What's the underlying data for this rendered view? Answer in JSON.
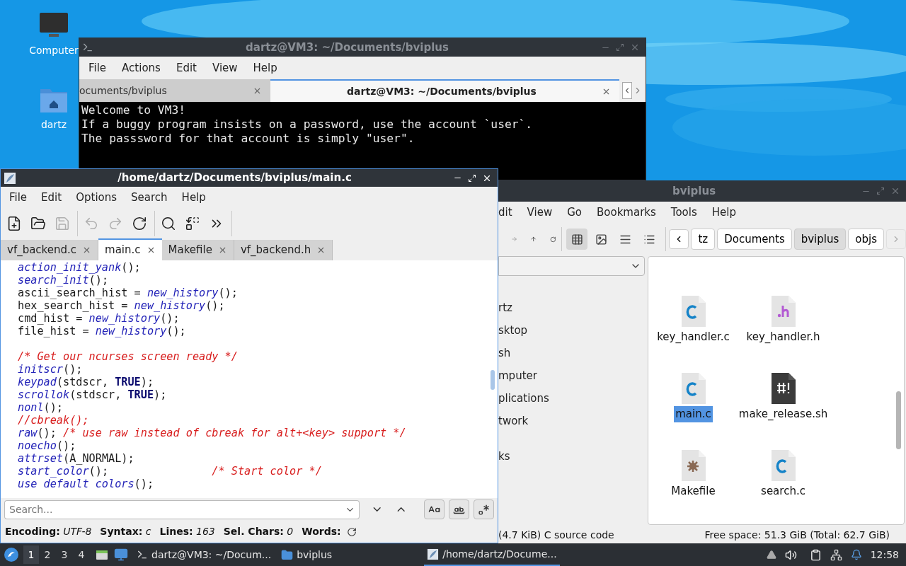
{
  "desktop": {
    "icons": [
      {
        "label": "Computer",
        "kind": "computer"
      },
      {
        "label": "dartz",
        "kind": "home"
      }
    ]
  },
  "terminal": {
    "title": "dartz@VM3: ~/Documents/bviplus",
    "menu": [
      "File",
      "Actions",
      "Edit",
      "View",
      "Help"
    ],
    "tabs": [
      {
        "label": "ocuments/bviplus",
        "selected": false
      },
      {
        "label": "dartz@VM3: ~/Documents/bviplus",
        "selected": true
      }
    ],
    "lines": [
      "Welcome to VM3!",
      "If a buggy program insists on a password, use the account `user`.",
      "The passsword for that account is simply \"user\"."
    ]
  },
  "editor": {
    "title": "/home/dartz/Documents/bviplus/main.c",
    "menu": [
      "File",
      "Edit",
      "Options",
      "Search",
      "Help"
    ],
    "toolbar": [
      [
        {
          "kind": "new",
          "disabled": false
        },
        {
          "kind": "open",
          "disabled": false
        },
        {
          "kind": "save",
          "disabled": true
        }
      ],
      [
        {
          "kind": "undo",
          "disabled": true
        },
        {
          "kind": "redo",
          "disabled": true
        },
        {
          "kind": "reload",
          "disabled": false
        }
      ],
      [
        {
          "kind": "find",
          "disabled": false
        },
        {
          "kind": "replace",
          "disabled": false
        },
        {
          "kind": "more",
          "disabled": false
        }
      ]
    ],
    "tabs": [
      {
        "label": "vf_backend.c",
        "selected": false
      },
      {
        "label": "main.c",
        "selected": true
      },
      {
        "label": "Makefile",
        "selected": false
      },
      {
        "label": "vf_backend.h",
        "selected": false
      }
    ],
    "code": [
      {
        "kind": "code",
        "segments": [
          {
            "kind": "func",
            "text": "action_init_yank"
          },
          {
            "kind": "plain",
            "text": "();"
          }
        ]
      },
      {
        "kind": "code",
        "segments": [
          {
            "kind": "func",
            "text": "search_init"
          },
          {
            "kind": "plain",
            "text": "();"
          }
        ]
      },
      {
        "kind": "code",
        "segments": [
          {
            "kind": "plain",
            "text": "ascii_search_hist = "
          },
          {
            "kind": "func",
            "text": "new_history"
          },
          {
            "kind": "plain",
            "text": "();"
          }
        ]
      },
      {
        "kind": "code",
        "segments": [
          {
            "kind": "plain",
            "text": "hex_search_hist = "
          },
          {
            "kind": "func",
            "text": "new_history"
          },
          {
            "kind": "plain",
            "text": "();"
          }
        ]
      },
      {
        "kind": "code",
        "segments": [
          {
            "kind": "plain",
            "text": "cmd_hist = "
          },
          {
            "kind": "func",
            "text": "new_history"
          },
          {
            "kind": "plain",
            "text": "();"
          }
        ]
      },
      {
        "kind": "code",
        "segments": [
          {
            "kind": "plain",
            "text": "file_hist = "
          },
          {
            "kind": "func",
            "text": "new_history"
          },
          {
            "kind": "plain",
            "text": "();"
          }
        ]
      },
      {
        "kind": "blank"
      },
      {
        "kind": "code",
        "segments": [
          {
            "kind": "comment",
            "text": "/* Get our ncurses screen ready */"
          }
        ]
      },
      {
        "kind": "code",
        "segments": [
          {
            "kind": "func",
            "text": "initscr"
          },
          {
            "kind": "plain",
            "text": "();"
          }
        ]
      },
      {
        "kind": "code",
        "segments": [
          {
            "kind": "func",
            "text": "keypad"
          },
          {
            "kind": "plain",
            "text": "(stdscr, "
          },
          {
            "kind": "const",
            "text": "TRUE"
          },
          {
            "kind": "plain",
            "text": ");"
          }
        ]
      },
      {
        "kind": "code",
        "segments": [
          {
            "kind": "func",
            "text": "scrollok"
          },
          {
            "kind": "plain",
            "text": "(stdscr, "
          },
          {
            "kind": "const",
            "text": "TRUE"
          },
          {
            "kind": "plain",
            "text": ");"
          }
        ]
      },
      {
        "kind": "code",
        "segments": [
          {
            "kind": "func",
            "text": "nonl"
          },
          {
            "kind": "plain",
            "text": "();"
          }
        ]
      },
      {
        "kind": "code",
        "segments": [
          {
            "kind": "comment",
            "text": "//cbreak();"
          }
        ]
      },
      {
        "kind": "code",
        "segments": [
          {
            "kind": "func",
            "text": "raw"
          },
          {
            "kind": "plain",
            "text": "(); "
          },
          {
            "kind": "comment",
            "text": "/* use raw instead of cbreak for alt+<key> support */"
          }
        ]
      },
      {
        "kind": "code",
        "segments": [
          {
            "kind": "func",
            "text": "noecho"
          },
          {
            "kind": "plain",
            "text": "();"
          }
        ]
      },
      {
        "kind": "code",
        "segments": [
          {
            "kind": "func",
            "text": "attrset"
          },
          {
            "kind": "plain",
            "text": "(A_NORMAL);"
          }
        ]
      },
      {
        "kind": "code",
        "segments": [
          {
            "kind": "func",
            "text": "start_color"
          },
          {
            "kind": "plain",
            "text": "();                "
          },
          {
            "kind": "comment",
            "text": "/* Start color */"
          }
        ]
      },
      {
        "kind": "code",
        "segments": [
          {
            "kind": "func",
            "text": "use default colors"
          },
          {
            "kind": "plain",
            "text": "();"
          }
        ]
      }
    ],
    "search": {
      "placeholder": "Search..."
    },
    "status": [
      {
        "label": "Encoding:",
        "value": "UTF-8"
      },
      {
        "label": "Syntax:",
        "value": "c"
      },
      {
        "label": "Lines:",
        "value": "163"
      },
      {
        "label": "Sel. Chars:",
        "value": "0"
      },
      {
        "label": "Words:"
      }
    ]
  },
  "file_manager": {
    "title": "bviplus",
    "menu": [
      "dit",
      "View",
      "Go",
      "Bookmarks",
      "Tools",
      "Help"
    ],
    "views": [
      {
        "kind": "icons",
        "selected": true
      },
      {
        "kind": "thumbnails",
        "selected": false
      },
      {
        "kind": "list",
        "selected": false
      },
      {
        "kind": "compact",
        "selected": false
      }
    ],
    "path": [
      {
        "label": "tz",
        "selected": false
      },
      {
        "label": "Documents",
        "selected": false
      },
      {
        "label": "bviplus",
        "selected": true
      },
      {
        "label": "objs",
        "selected": false
      }
    ],
    "sidebar": {
      "items": [
        "rtz",
        "sktop",
        "sh",
        "mputer",
        "plications",
        "twork"
      ],
      "heading": "ks"
    },
    "files": [
      {
        "name": "key_handler.c",
        "kind": "c",
        "selected": false
      },
      {
        "name": "key_handler.h",
        "kind": "h",
        "selected": false
      },
      {
        "name": "main.c",
        "kind": "c",
        "selected": true
      },
      {
        "name": "make_release.sh",
        "kind": "script",
        "selected": false
      },
      {
        "name": "Makefile",
        "kind": "makefile",
        "selected": false
      },
      {
        "name": "search.c",
        "kind": "c",
        "selected": false
      }
    ],
    "status_left": "(4.7 KiB) C source code",
    "status_right": "Free space: 51.3 GiB (Total: 62.7 GiB)"
  },
  "taskbar": {
    "workspaces": [
      {
        "label": "1",
        "selected": true
      },
      {
        "label": "2",
        "selected": false
      },
      {
        "label": "3",
        "selected": false
      },
      {
        "label": "4",
        "selected": false
      }
    ],
    "tasks": [
      {
        "label": "dartz@VM3: ~/Docum...",
        "kind": "terminal",
        "selected": false
      },
      {
        "label": "bviplus",
        "kind": "folder",
        "selected": false
      },
      {
        "label": "/home/dartz/Docume...",
        "kind": "editor",
        "selected": true
      }
    ],
    "clock": "12:58"
  }
}
